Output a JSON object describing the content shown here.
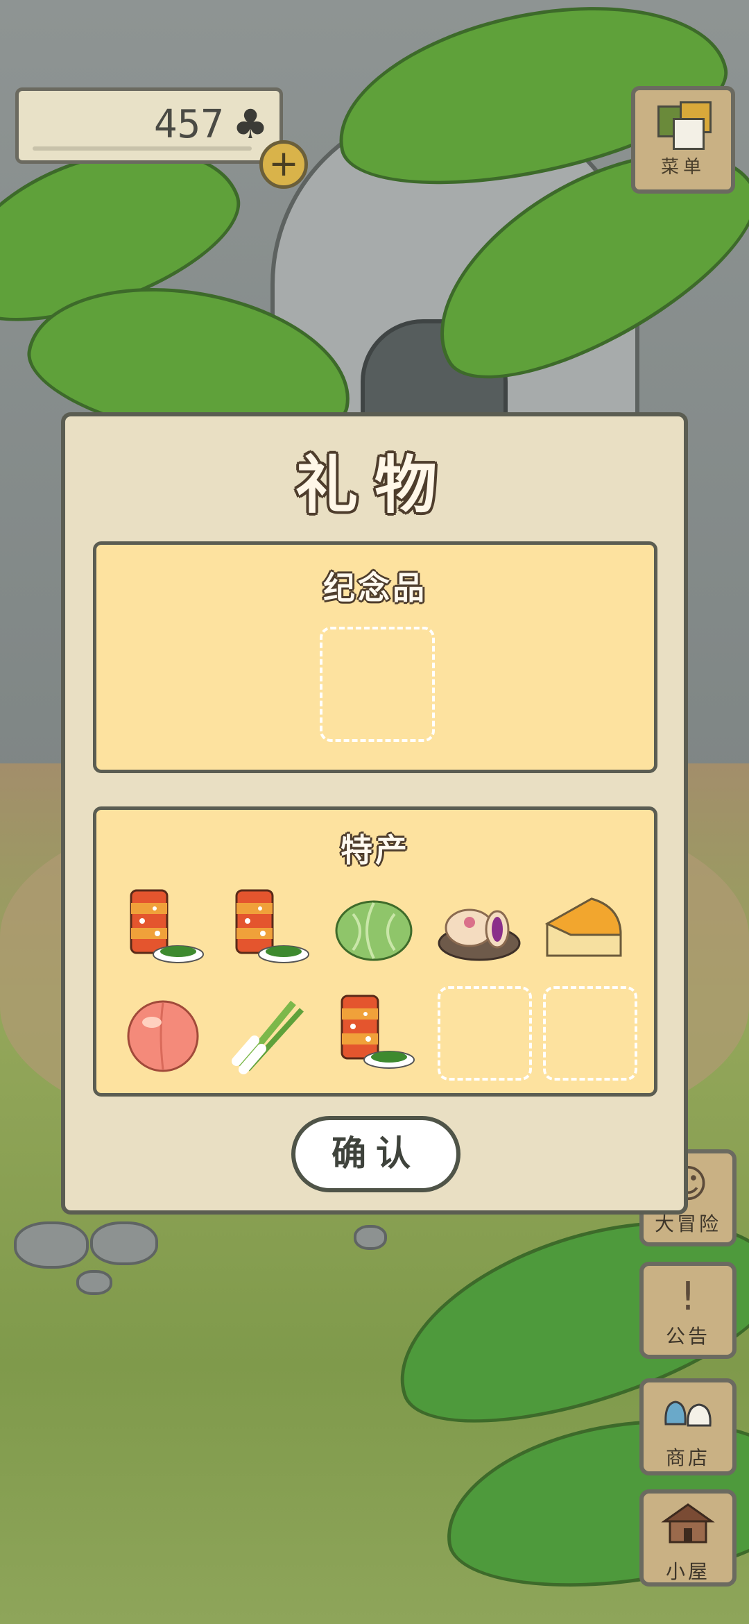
{
  "hud": {
    "clover_count": "457",
    "clover_icon": "clover-icon",
    "add_clover_icon": "+",
    "menu_label": "菜单"
  },
  "side_buttons": [
    {
      "label": "大冒险",
      "icon": "frog-icon"
    },
    {
      "label": "公告",
      "icon": "!"
    },
    {
      "label": "商店",
      "icon": "bags-icon"
    },
    {
      "label": "小屋",
      "icon": "house-icon"
    }
  ],
  "dialog": {
    "title": "礼物",
    "souvenir_section": {
      "title": "纪念品",
      "slots": [
        "empty"
      ]
    },
    "specialty_section": {
      "title": "特产",
      "items": [
        {
          "name": "tea-can-with-leaves"
        },
        {
          "name": "tea-can-with-leaves"
        },
        {
          "name": "cabbage"
        },
        {
          "name": "pastry-on-plate"
        },
        {
          "name": "cheese-wedge"
        },
        {
          "name": "peach"
        },
        {
          "name": "green-onions"
        },
        {
          "name": "tea-can-with-leaves"
        },
        {
          "name": "empty"
        },
        {
          "name": "empty"
        }
      ]
    },
    "confirm_label": "确认"
  },
  "colors": {
    "panel": "#fde29f",
    "dialog": "#e9dfc3",
    "border": "#5b5d52",
    "wood": "#c9b184"
  }
}
